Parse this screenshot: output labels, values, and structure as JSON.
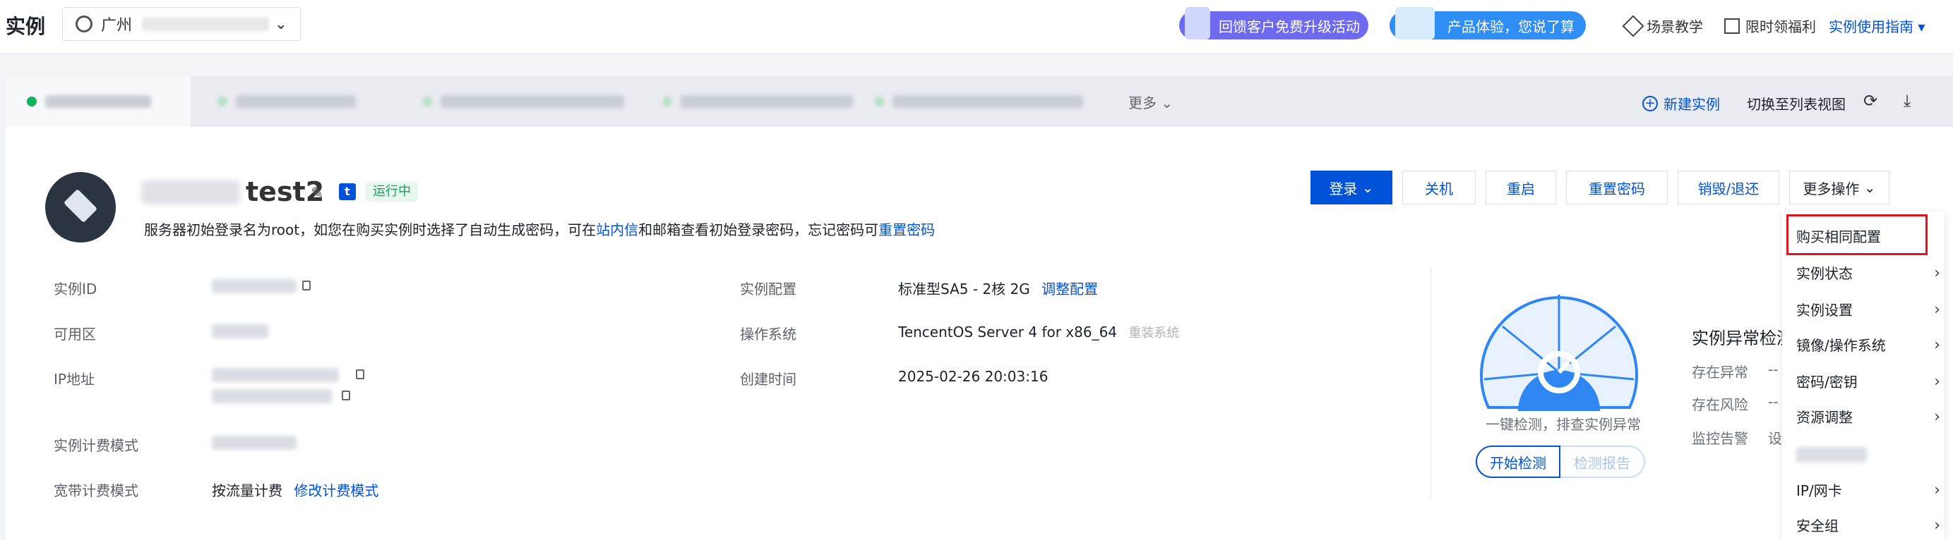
{
  "header": {
    "title": "实例",
    "region": "广州",
    "promos": [
      {
        "label": "回馈客户免费升级活动"
      },
      {
        "label": "产品体验，您说了算"
      }
    ],
    "links": {
      "scenario": "场景教学",
      "benefit": "限时领福利",
      "guide": "实例使用指南 ▾"
    }
  },
  "tabs": {
    "more": "更多",
    "new_instance": "新建实例",
    "switch_view": "切换至列表视图"
  },
  "instance": {
    "name": "test2",
    "status": "运行中",
    "notice_parts": {
      "p1": "服务器初始登录名为root，如您在购买实例时选择了自动生成密码，可在",
      "link1": "站内信",
      "p2": "和邮箱查看初始登录密码，忘记密码可",
      "link2": "重置密码"
    },
    "actions": {
      "login": "登录",
      "shutdown": "关机",
      "restart": "重启",
      "reset_password": "重置密码",
      "destroy": "销毁/退还",
      "more": "更多操作"
    },
    "fields": {
      "id_label": "实例ID",
      "zone_label": "可用区",
      "ip_label": "IP地址",
      "billing_label": "实例计费模式",
      "bandwidth_label": "宽带计费模式",
      "bandwidth_value": "按流量计费",
      "bandwidth_link": "修改计费模式",
      "config_label": "实例配置",
      "config_value": "标准型SA5 - 2核 2G",
      "config_link": "调整配置",
      "os_label": "操作系统",
      "os_value": "TencentOS Server 4 for x86_64",
      "os_link": "重装系统",
      "created_label": "创建时间",
      "created_value": "2025-02-26 20:03:16"
    }
  },
  "detection": {
    "caption": "一键检测，排查实例异常",
    "start": "开始检测",
    "report": "检测报告",
    "title": "实例异常检测",
    "rows": [
      {
        "label": "存在异常",
        "value": "--"
      },
      {
        "label": "存在风险",
        "value": "--"
      },
      {
        "label": "监控告警",
        "value": "设"
      }
    ]
  },
  "dropdown": {
    "items": [
      {
        "label": "购买相同配置",
        "submenu": false
      },
      {
        "label": "实例状态",
        "submenu": true
      },
      {
        "label": "实例设置",
        "submenu": true
      },
      {
        "label": "镜像/操作系统",
        "submenu": true
      },
      {
        "label": "密码/密钥",
        "submenu": true
      },
      {
        "label": "资源调整",
        "submenu": true
      },
      {
        "label": "IP/网卡",
        "submenu": true
      },
      {
        "label": "安全组",
        "submenu": true
      }
    ]
  },
  "colors": {
    "primary": "#0052d9",
    "running": "#12b25e",
    "highlight": "#e0141d"
  }
}
